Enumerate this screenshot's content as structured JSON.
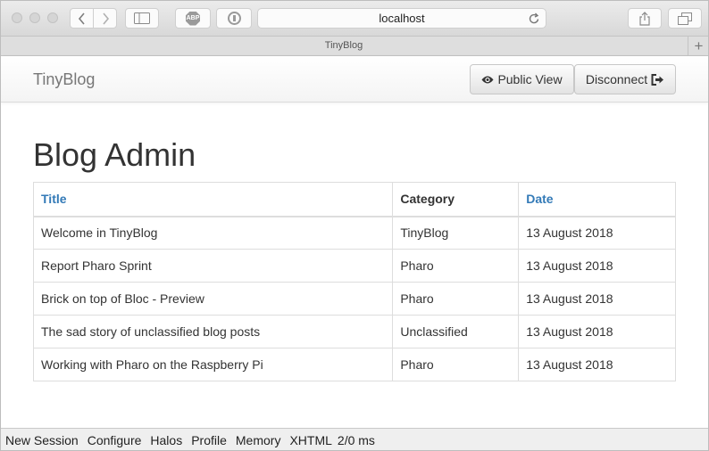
{
  "browser": {
    "url": "localhost",
    "tab_title": "TinyBlog",
    "abp_label": "ABP"
  },
  "navbar": {
    "brand": "TinyBlog",
    "public_view_label": "Public View",
    "disconnect_label": "Disconnect"
  },
  "page": {
    "title": "Blog Admin"
  },
  "table": {
    "headers": {
      "title": "Title",
      "category": "Category",
      "date": "Date"
    },
    "rows": [
      {
        "title": "Welcome in TinyBlog",
        "category": "TinyBlog",
        "date": "13 August 2018"
      },
      {
        "title": "Report Pharo Sprint",
        "category": "Pharo",
        "date": "13 August 2018"
      },
      {
        "title": "Brick on top of Bloc - Preview",
        "category": "Pharo",
        "date": "13 August 2018"
      },
      {
        "title": "The sad story of unclassified blog posts",
        "category": "Unclassified",
        "date": "13 August 2018"
      },
      {
        "title": "Working with Pharo on the Raspberry Pi",
        "category": "Pharo",
        "date": "13 August 2018"
      }
    ]
  },
  "toolbar": {
    "new_session": "New Session",
    "configure": "Configure",
    "halos": "Halos",
    "profile": "Profile",
    "memory": "Memory",
    "xhtml": "XHTML",
    "timing": "2/0 ms"
  },
  "colors": {
    "link": "#337ab7",
    "text": "#333333",
    "border": "#dddddd"
  },
  "icons": {
    "public_view": "eye-icon",
    "disconnect": "sign-out-icon"
  }
}
